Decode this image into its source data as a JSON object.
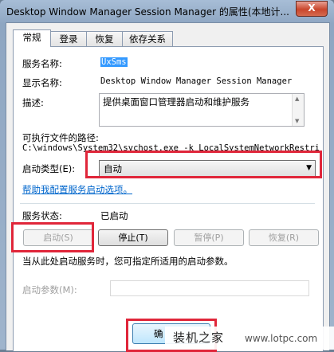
{
  "window": {
    "title": "Desktop Window Manager Session Manager 的属性(本地计...",
    "close_label": "X"
  },
  "tabs": [
    {
      "label": "常规"
    },
    {
      "label": "登录"
    },
    {
      "label": "恢复"
    },
    {
      "label": "依存关系"
    }
  ],
  "general": {
    "service_name_label": "服务名称:",
    "service_name_value": "UxSms",
    "display_name_label": "显示名称:",
    "display_name_value": "Desktop Window Manager Session Manager",
    "description_label": "描述:",
    "description_value": "提供桌面窗口管理器启动和维护服务",
    "exe_path_label": "可执行文件的路径:",
    "exe_path_value": "C:\\windows\\System32\\svchost.exe -k LocalSystemNetworkRestric",
    "startup_type_label": "启动类型(E):",
    "startup_type_value": "自动",
    "help_link": "帮助我配置服务启动选项。",
    "status_label": "服务状态:",
    "status_value": "已启动",
    "buttons": {
      "start": "启动(S)",
      "stop": "停止(T)",
      "pause": "暂停(P)",
      "resume": "恢复(R)"
    },
    "hint": "当从此处启动服务时，您可指定所适用的启动参数。",
    "start_params_label": "启动参数(M):",
    "start_params_value": ""
  },
  "footer": {
    "ok_label": "确"
  },
  "watermark": {
    "text": "装机之家",
    "url": "www.lotpc.com"
  },
  "colors": {
    "highlight_box": "#e0263a",
    "link": "#0066cc",
    "selection": "#3399ff"
  }
}
